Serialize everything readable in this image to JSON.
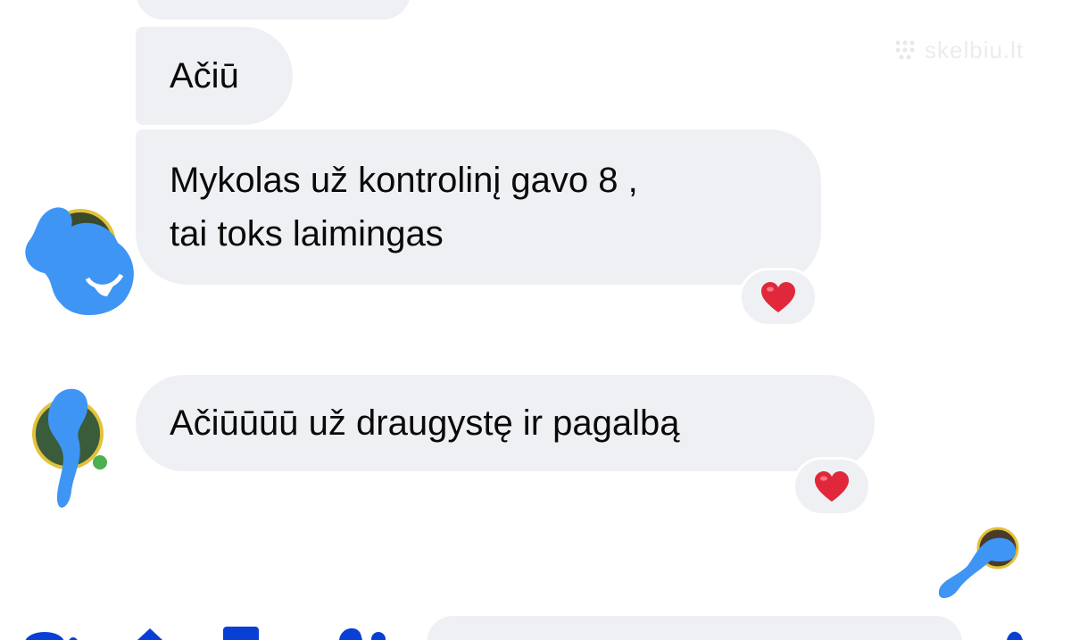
{
  "colors": {
    "bubble_bg": "#eff0f4",
    "reaction_heart": "#e0283a",
    "scribble_blue": "#3f95f3",
    "toolbar_blue": "#0a3fd6"
  },
  "watermark": {
    "text": "skelbiu.lt"
  },
  "messages": [
    {
      "text": ""
    },
    {
      "text": "Ačiū"
    },
    {
      "text": "Mykolas už kontrolinį gavo 8 ,\ntai toks laimingas",
      "reaction": "heart-icon"
    },
    {
      "text": "Ačiūūūū už draugystę ir pagalbą",
      "reaction": "heart-icon"
    }
  ],
  "composer": {
    "placeholder": ""
  }
}
